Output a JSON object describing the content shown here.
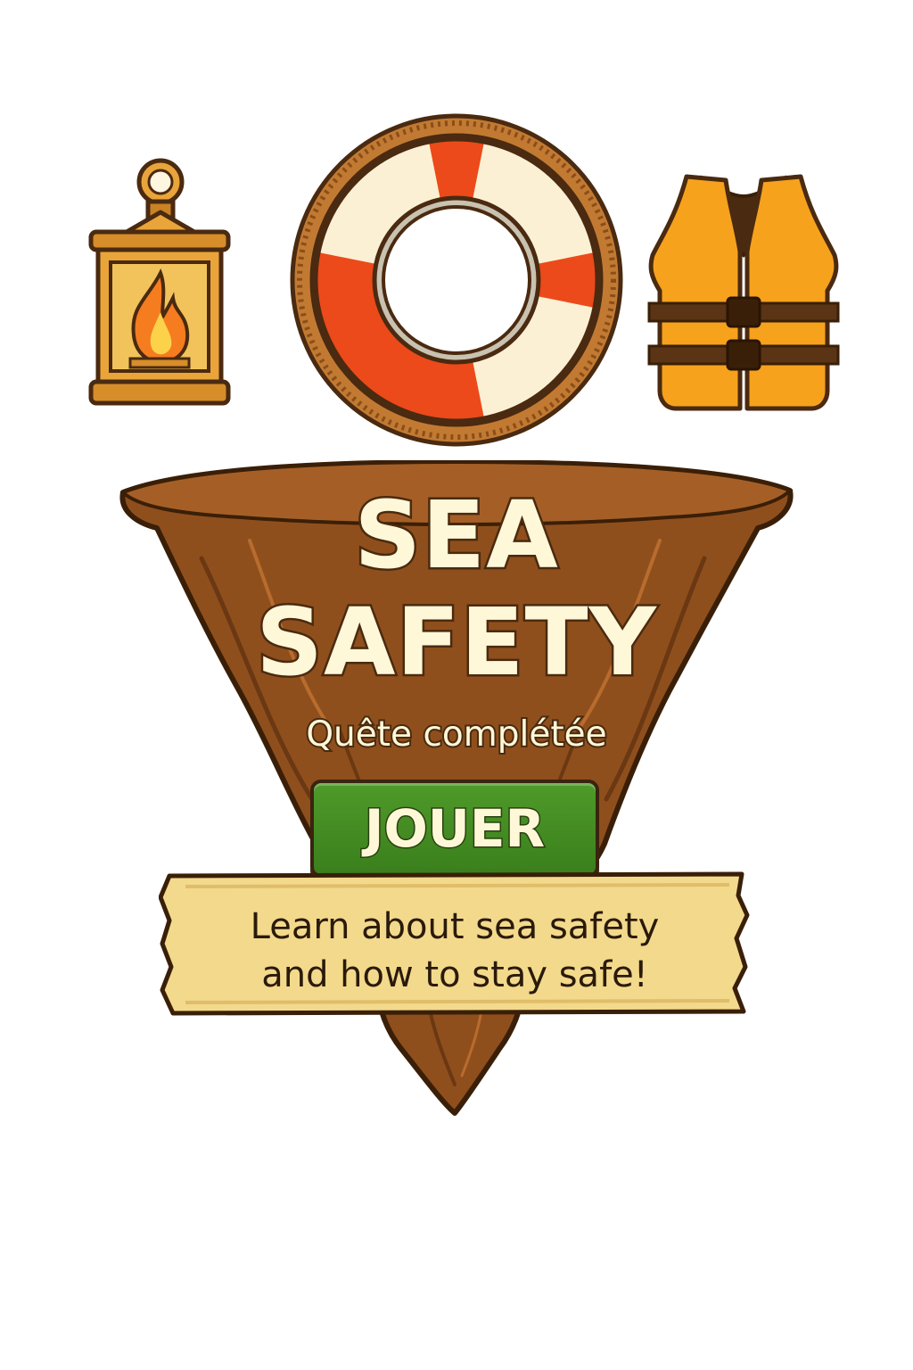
{
  "icons": {
    "lantern": "lantern-icon",
    "lifebuoy": "lifebuoy-icon",
    "life_vest": "life-vest-icon",
    "island": "floating-island"
  },
  "title": {
    "line1": "SEA",
    "line2": "SAFETY"
  },
  "status": "Quête complétée",
  "play_button": {
    "label": "JOUER"
  },
  "description": {
    "line1": "Learn about sea safety",
    "line2": "and how to stay safe!"
  },
  "colors": {
    "island_brown": "#8f4f1c",
    "title_text": "#fff8d8",
    "button_green": "#3f861f",
    "banner_parchment": "#f3d98c",
    "lifebuoy_red": "#ec4a1a",
    "vest_orange": "#f6a21d"
  }
}
